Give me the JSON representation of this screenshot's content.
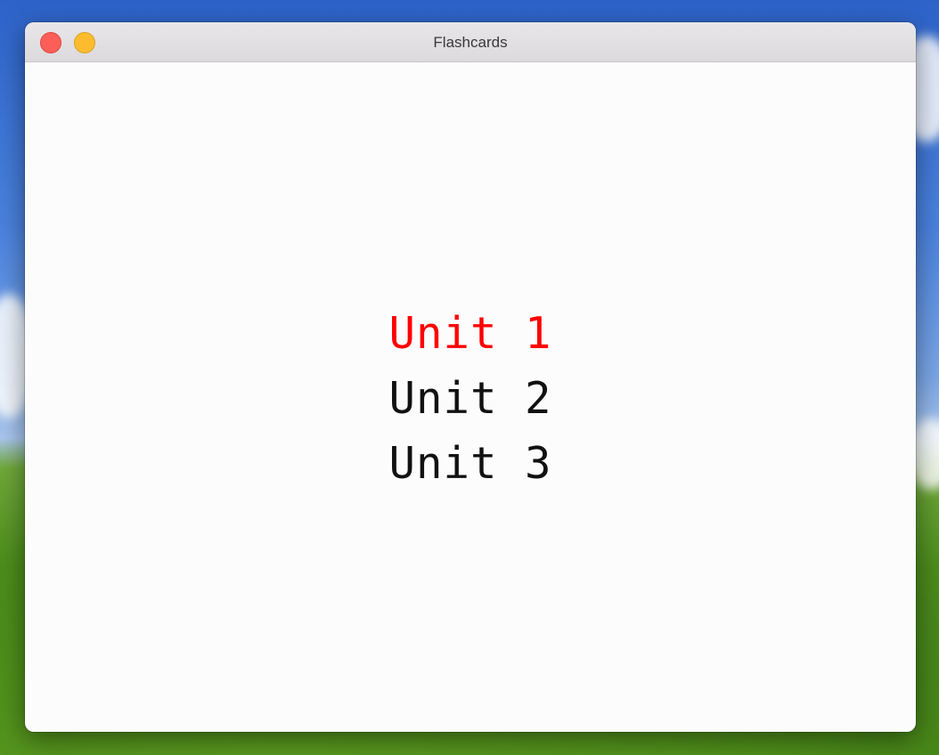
{
  "window": {
    "title": "Flashcards"
  },
  "units": {
    "items": [
      {
        "label": "Unit 1",
        "selected": true
      },
      {
        "label": "Unit 2",
        "selected": false
      },
      {
        "label": "Unit 3",
        "selected": false
      }
    ]
  },
  "colors": {
    "selected_text": "#ff0000",
    "default_text": "#111111",
    "close_button": "#fc5f57",
    "minimize_button": "#fdbc2e"
  }
}
